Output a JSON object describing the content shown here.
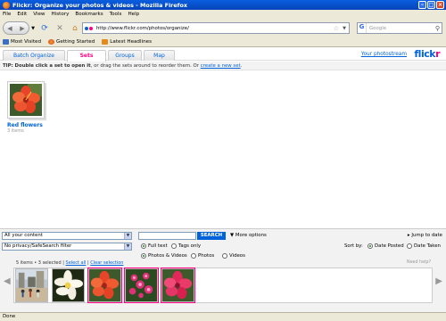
{
  "window": {
    "title": "Flickr: Organize your photos & videos - Mozilla Firefox"
  },
  "menu": [
    "File",
    "Edit",
    "View",
    "History",
    "Bookmarks",
    "Tools",
    "Help"
  ],
  "nav": {
    "url": "http://www.flickr.com/photos/organize/",
    "search_placeholder": "Google"
  },
  "bookmarks": [
    "Most Visited",
    "Getting Started",
    "Latest Headlines"
  ],
  "app": {
    "tabs": [
      "Batch Organize",
      "Sets",
      "Groups",
      "Map"
    ],
    "active_tab": "Sets",
    "your_photostream": "Your photostream",
    "logo_a": "flick",
    "logo_b": "r",
    "tip_prefix": "TIP:",
    "tip_bold": "Double click a set to open it",
    "tip_rest": ", or drag the sets around to reorder them. Or",
    "tip_link": "create a new set",
    "tip_end": ".",
    "set": {
      "name": "Red flowers",
      "count": "3 items"
    }
  },
  "panel": {
    "content_filter": "All your content",
    "privacy_filter": "No privacy/SafeSearch filter",
    "search_button": "SEARCH",
    "more_options": "More options",
    "jump_to_date": "Jump to date",
    "full_text": "Full text",
    "tags_only": "Tags only",
    "photos_videos": "Photos & Videos",
    "photos": "Photos",
    "videos": "Videos",
    "sort_by": "Sort by:",
    "date_posted": "Date Posted",
    "date_taken": "Date Taken",
    "strip_info": "5 items • 3 selected |",
    "select_all": "Select all",
    "clear_selection": "Clear selection",
    "need_help": "Need help?"
  },
  "status": "Done",
  "colors": {
    "flickr_blue": "#0063dc",
    "flickr_pink": "#ff0084",
    "xp_blue": "#0a5fe0"
  }
}
